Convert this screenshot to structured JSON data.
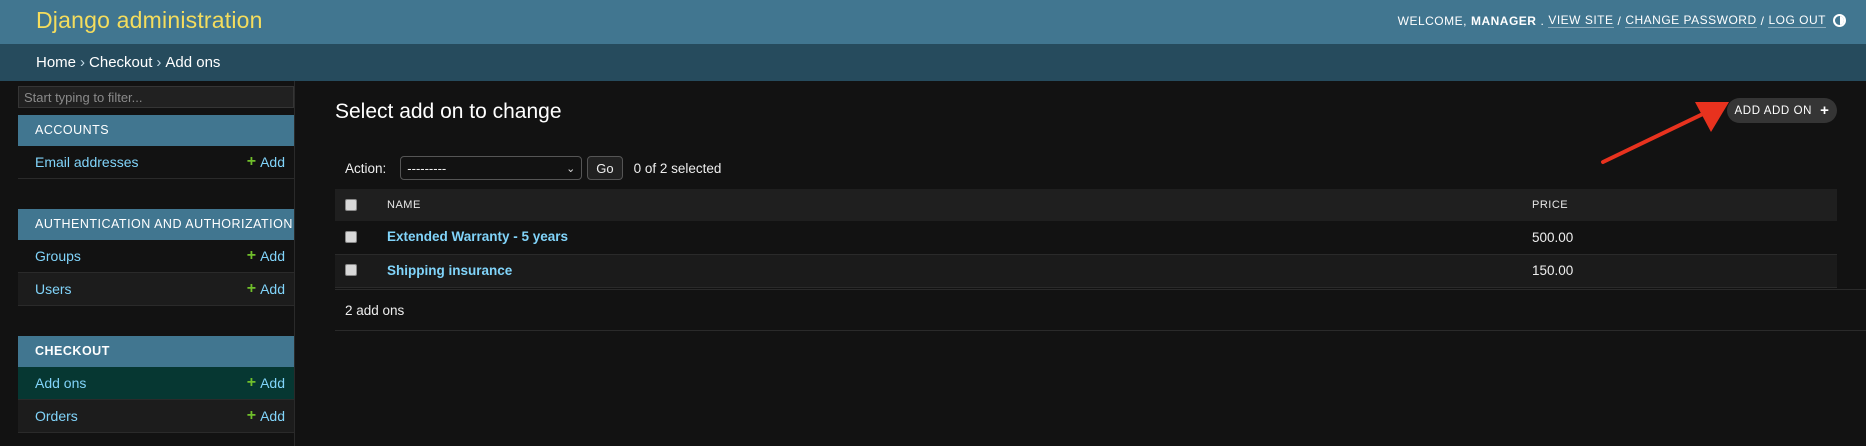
{
  "header": {
    "brand": "Django administration",
    "welcome": "WELCOME,",
    "username": "MANAGER",
    "view_site": "VIEW SITE",
    "change_password": "CHANGE PASSWORD",
    "log_out": "LOG OUT",
    "sep": "/",
    "theme_icon": "theme-toggle-icon"
  },
  "breadcrumbs": {
    "home": "Home",
    "app": "Checkout",
    "current": "Add ons",
    "sep": "›"
  },
  "sidebar": {
    "filter_placeholder": "Start typing to filter...",
    "modules": [
      {
        "caption": "ACCOUNTS",
        "models": [
          {
            "label": "Email addresses",
            "add": "Add"
          }
        ]
      },
      {
        "caption": "AUTHENTICATION AND AUTHORIZATION",
        "models": [
          {
            "label": "Groups",
            "add": "Add"
          },
          {
            "label": "Users",
            "add": "Add"
          }
        ]
      },
      {
        "caption": "CHECKOUT",
        "models": [
          {
            "label": "Add ons",
            "add": "Add"
          },
          {
            "label": "Orders",
            "add": "Add"
          }
        ]
      }
    ]
  },
  "content": {
    "title": "Select add on to change",
    "add_button": "ADD ADD ON",
    "action_label": "Action:",
    "action_selected": "---------",
    "go": "Go",
    "selection_counter": "0 of 2 selected",
    "columns": [
      "NAME",
      "PRICE"
    ],
    "rows": [
      {
        "name": "Extended Warranty - 5 years",
        "price": "500.00"
      },
      {
        "name": "Shipping insurance",
        "price": "150.00"
      }
    ],
    "paginator": "2 add ons"
  },
  "colors": {
    "header_bg": "#417690",
    "brand": "#f5dd5d",
    "breadcrumb_bg": "#264b5d",
    "link": "#81d4fa",
    "add_plus": "#70bf2b",
    "annotation_arrow": "#e8321e"
  }
}
